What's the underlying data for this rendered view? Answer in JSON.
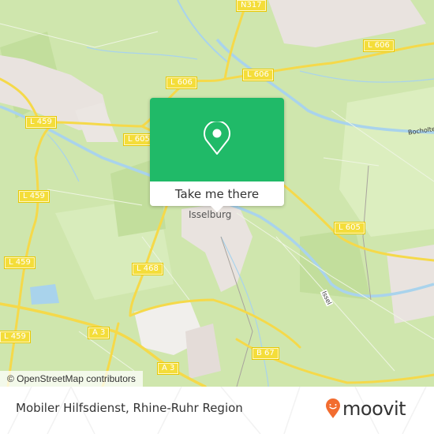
{
  "map": {
    "road_shields": [
      {
        "id": "n317",
        "label": "N317"
      },
      {
        "id": "l606-a",
        "label": "L 606"
      },
      {
        "id": "l606-b",
        "label": "L 606"
      },
      {
        "id": "l606-c",
        "label": "L 606"
      },
      {
        "id": "l459-a",
        "label": "L 459"
      },
      {
        "id": "l605-a",
        "label": "L 605"
      },
      {
        "id": "l459-b",
        "label": "L 459"
      },
      {
        "id": "l459-c",
        "label": "L 459"
      },
      {
        "id": "l459-d",
        "label": "L 459"
      },
      {
        "id": "l468",
        "label": "L 468"
      },
      {
        "id": "l605-b",
        "label": "L 605"
      },
      {
        "id": "a3-a",
        "label": "A 3"
      },
      {
        "id": "a3-b",
        "label": "A 3"
      },
      {
        "id": "b67",
        "label": "B 67"
      }
    ],
    "place_labels": {
      "town": "Isselburg",
      "bocholt": "Bocholter",
      "river": "Issel"
    },
    "colors": {
      "land": "#cfe6ad",
      "forest": "#c3dfa0",
      "urban": "#e9e3df",
      "water": "#a9d3ec",
      "road": "#f5d94a",
      "popup": "#20ba68",
      "brand": "#f26c2f"
    }
  },
  "popup": {
    "icon": "map-pin-icon",
    "action_label": "Take me there"
  },
  "attribution": "© OpenStreetMap contributors",
  "footer": {
    "title": "Mobiler Hilfsdienst, Rhine-Ruhr Region",
    "brand": "moovit"
  }
}
